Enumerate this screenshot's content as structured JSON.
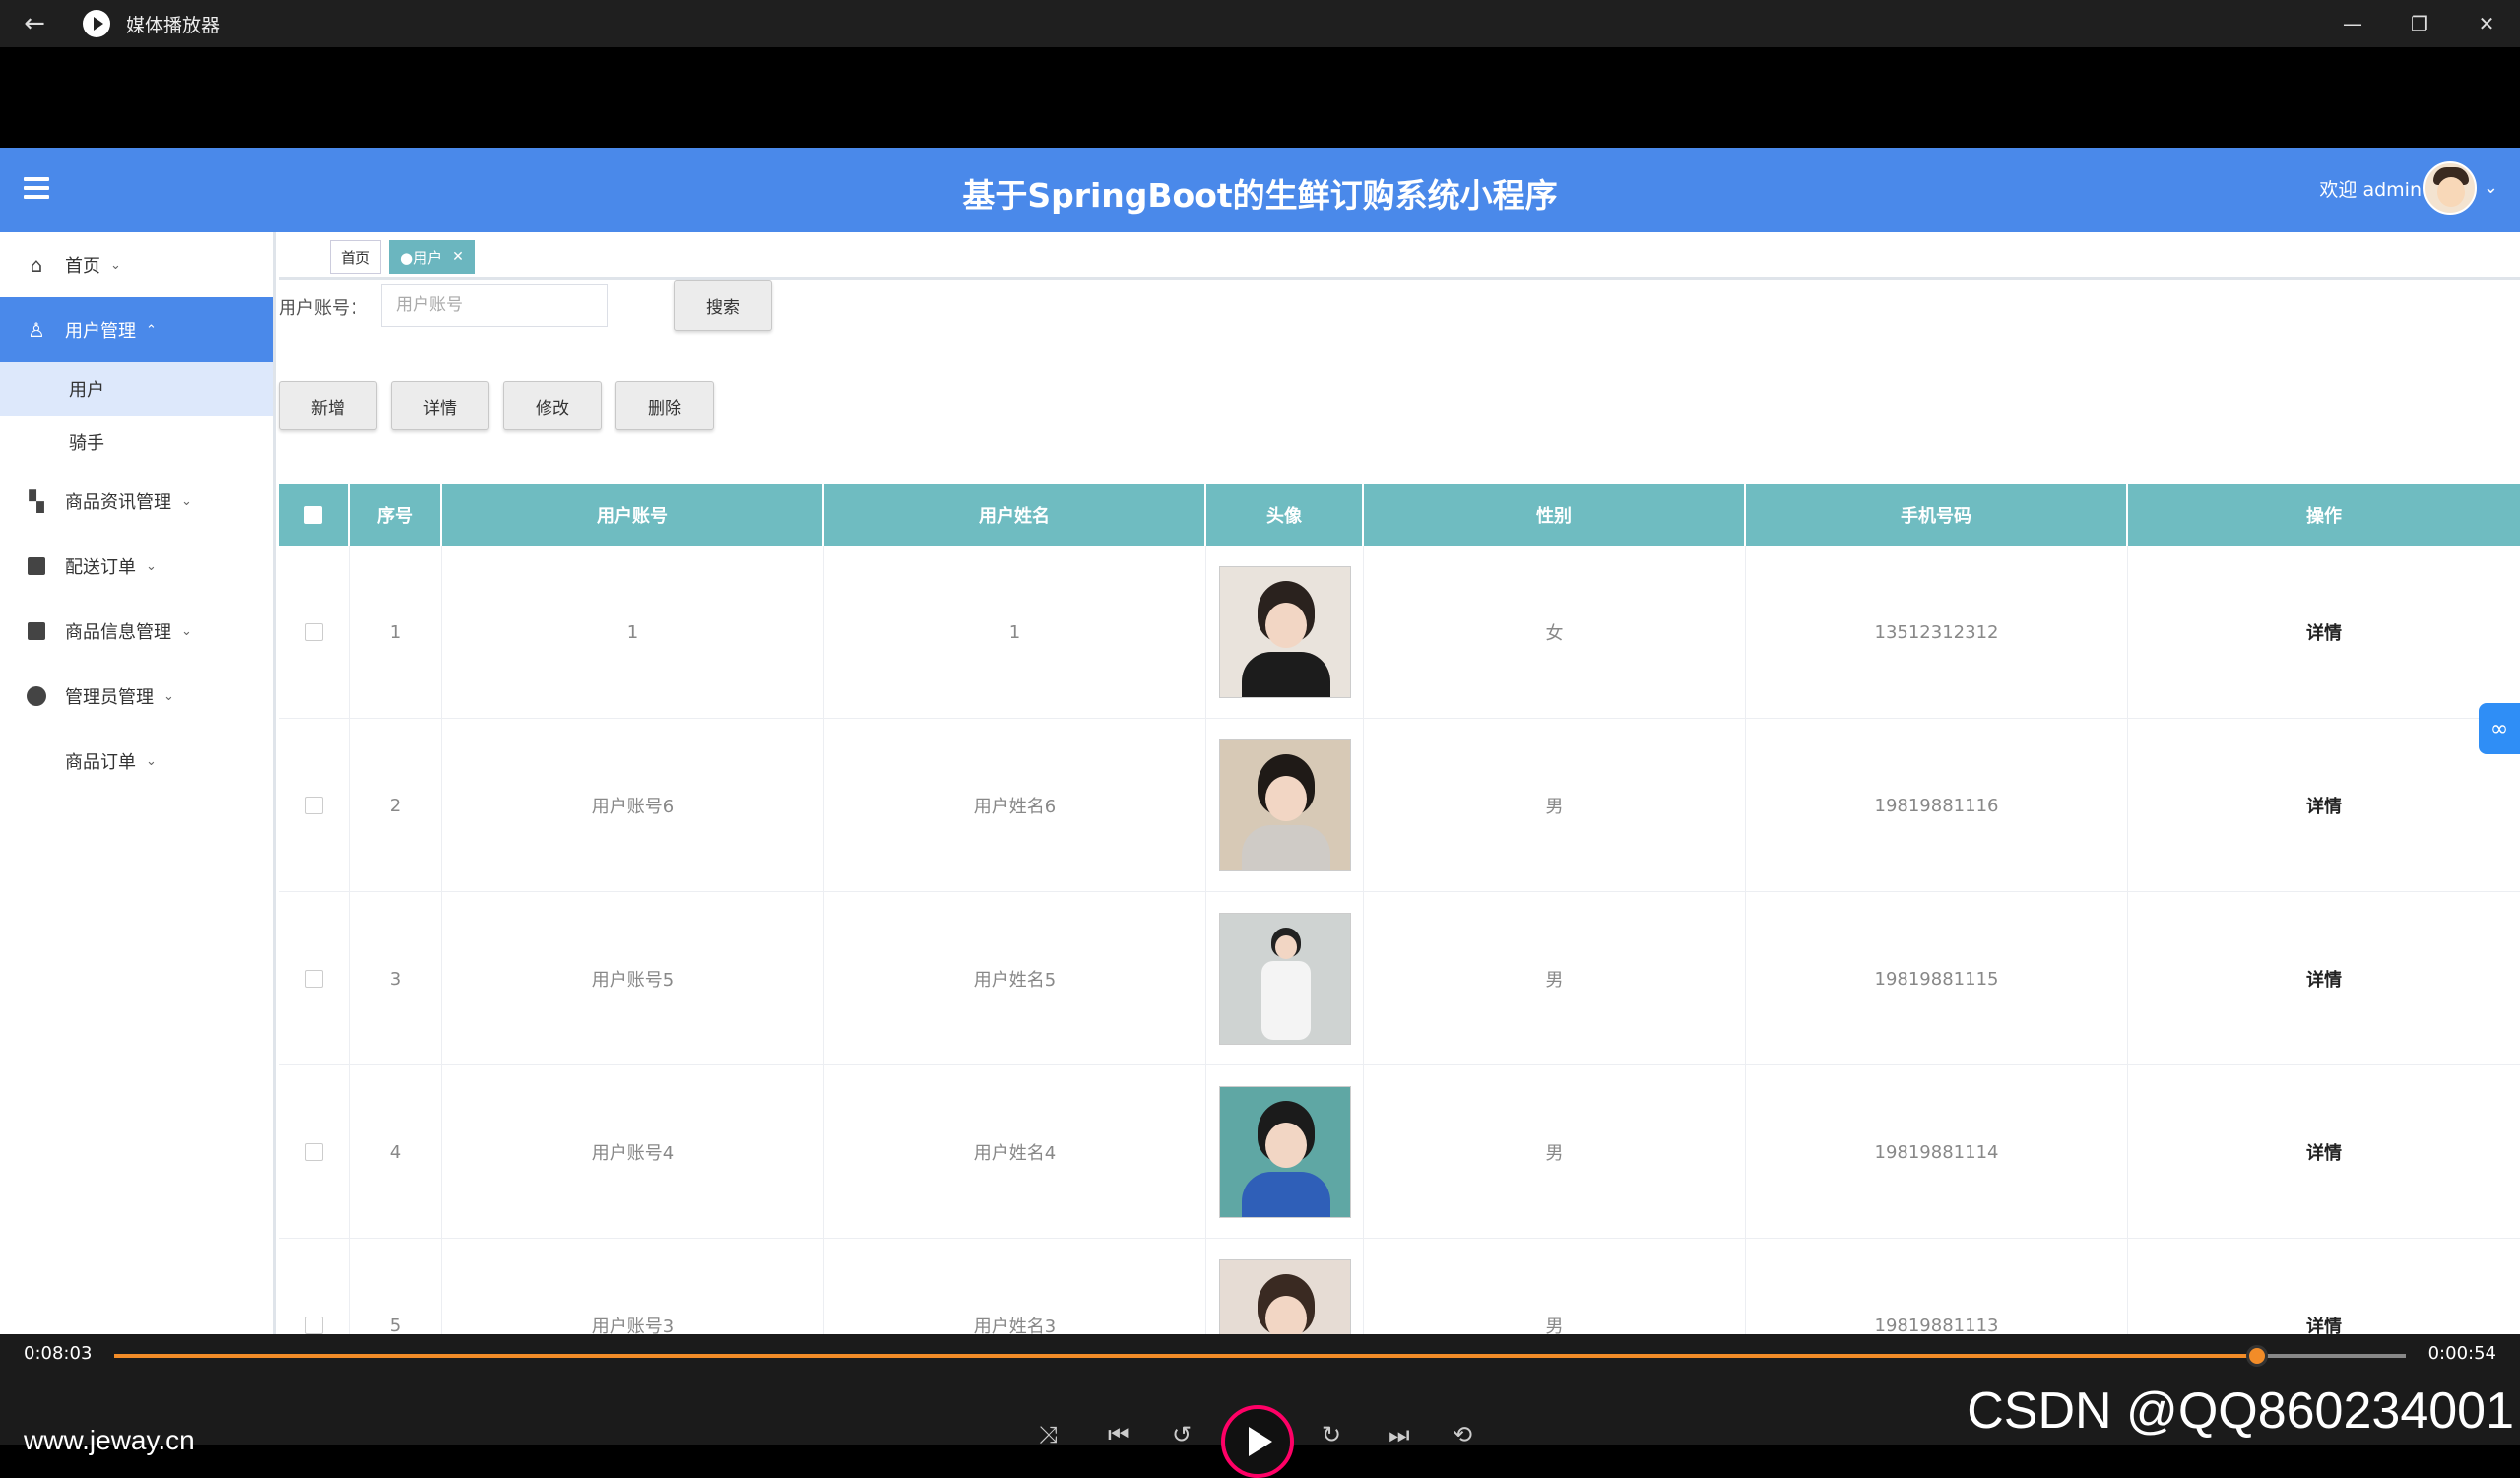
{
  "window": {
    "title": "媒体播放器"
  },
  "header": {
    "title": "基于SpringBoot的生鲜订购系统小程序",
    "welcome": "欢迎 admin"
  },
  "sidebar": {
    "items": [
      {
        "label": "首页",
        "icon": "home-icon"
      },
      {
        "label": "用户管理",
        "icon": "user-icon",
        "active": true,
        "children": [
          {
            "label": "用户",
            "selected": true
          },
          {
            "label": "骑手"
          }
        ]
      },
      {
        "label": "商品资讯管理",
        "icon": "grid-icon"
      },
      {
        "label": "配送订单",
        "icon": "list-icon"
      },
      {
        "label": "商品信息管理",
        "icon": "list-icon"
      },
      {
        "label": "管理员管理",
        "icon": "check-circle-icon"
      },
      {
        "label": "商品订单",
        "icon": "none"
      }
    ]
  },
  "tabs": [
    {
      "label": "首页"
    },
    {
      "label": "●用户",
      "active": true
    }
  ],
  "search": {
    "label": "用户账号：",
    "placeholder": "用户账号",
    "button": "搜索"
  },
  "actions": {
    "add": "新增",
    "detail": "详情",
    "edit": "修改",
    "delete": "删除"
  },
  "table": {
    "headers": [
      "序号",
      "用户账号",
      "用户姓名",
      "头像",
      "性别",
      "手机号码",
      "操作"
    ],
    "rows": [
      {
        "index": "1",
        "account": "1",
        "name": "1",
        "gender": "女",
        "phone": "13512312312",
        "op": "详情"
      },
      {
        "index": "2",
        "account": "用户账号6",
        "name": "用户姓名6",
        "gender": "男",
        "phone": "19819881116",
        "op": "详情"
      },
      {
        "index": "3",
        "account": "用户账号5",
        "name": "用户姓名5",
        "gender": "男",
        "phone": "19819881115",
        "op": "详情"
      },
      {
        "index": "4",
        "account": "用户账号4",
        "name": "用户姓名4",
        "gender": "男",
        "phone": "19819881114",
        "op": "详情"
      },
      {
        "index": "5",
        "account": "用户账号3",
        "name": "用户姓名3",
        "gender": "男",
        "phone": "19819881113",
        "op": "详情"
      }
    ]
  },
  "player": {
    "elapsed": "0:08:03",
    "remaining": "0:00:54",
    "progress": 0.935,
    "watermark": "CSDN @QQ860234001",
    "site": "www.jeway.cn"
  },
  "colors": {
    "header": "#4a89ea",
    "table_header": "#6fbcc1",
    "progress": "#f28c28"
  }
}
